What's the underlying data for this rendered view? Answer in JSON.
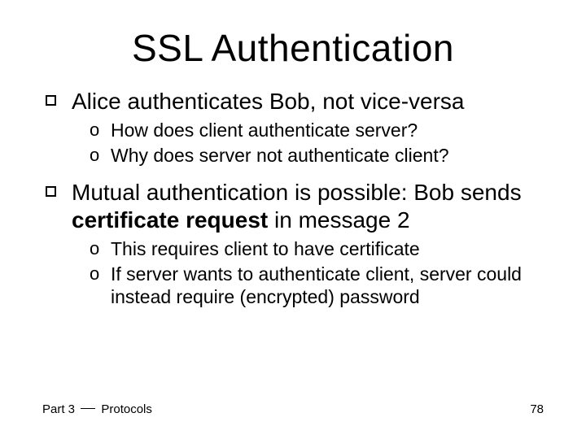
{
  "title": "SSL Authentication",
  "bullets": [
    {
      "text": "Alice authenticates Bob, not vice-versa",
      "sub": [
        "How does client authenticate server?",
        "Why does server not authenticate client?"
      ]
    },
    {
      "text_prefix": "Mutual authentication is possible: Bob sends ",
      "text_bold": "certificate request",
      "text_suffix": " in message 2",
      "sub": [
        "This requires client to have certificate",
        "If server wants to authenticate client, server could instead require (encrypted) password"
      ]
    }
  ],
  "footer_part": "Part 3 ",
  "footer_topic": " Protocols",
  "page_number": "78"
}
